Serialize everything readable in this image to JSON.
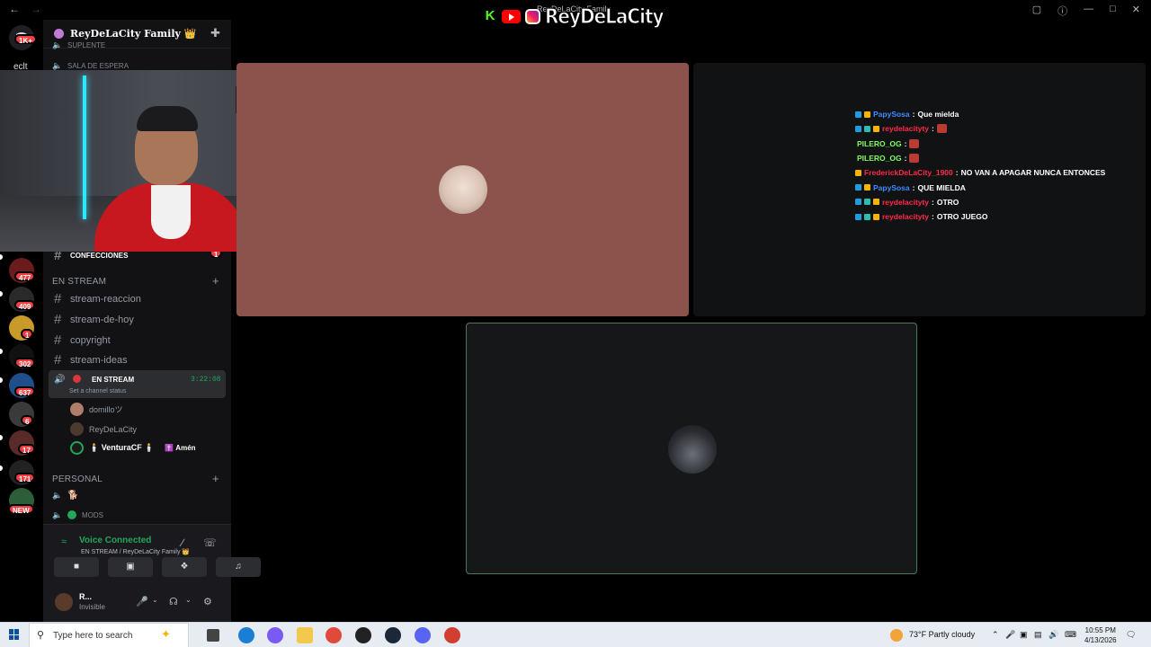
{
  "window": {
    "title": "ReyDeLaCity Family",
    "back": "←",
    "forward": "→",
    "controls": [
      "inbox-icon",
      "help-icon",
      "minimize-icon",
      "maximize-icon",
      "close-icon"
    ]
  },
  "overlay_brand": {
    "name": "ReyDeLaCity",
    "icons": [
      "kick-icon",
      "youtube-icon",
      "instagram-icon"
    ],
    "colors": {
      "kick": "#53fc18",
      "youtube": "#ff0000"
    }
  },
  "rail": {
    "top_badge": "1K+",
    "top_label": "eclt",
    "servers": [
      {
        "badge": "477"
      },
      {
        "badge": "409"
      },
      {
        "badge": "1"
      },
      {
        "badge": "302"
      },
      {
        "badge": "637"
      },
      {
        "badge": "6"
      },
      {
        "badge": "17"
      },
      {
        "badge": "171"
      },
      {
        "badge": "NEW"
      }
    ]
  },
  "sidebar": {
    "server_name": "ReyDeLaCity Family 👑",
    "top_voice": [
      {
        "label": "SUPLENTE"
      },
      {
        "label": "SALA DE ESPERA"
      }
    ],
    "confesiones": {
      "label": "CONFECCIONES",
      "badge": "1"
    },
    "category_stream": "EN STREAM",
    "text_channels": [
      "stream-reaccion",
      "stream-de-hoy",
      "copyright",
      "stream-ideas"
    ],
    "active_voice": {
      "name": "EN STREAM",
      "status": "Set a channel status",
      "timer": "3:22:08"
    },
    "members": [
      {
        "name": "domilloツ",
        "tag": ""
      },
      {
        "name": "ReyDeLaCity",
        "tag": ""
      },
      {
        "name": "🕯️ VenturaCF 🕯️",
        "tag": "✝️ Amén"
      }
    ],
    "category_personal": "PERSONAL",
    "personal_voice": [
      {
        "label": "🐕"
      },
      {
        "label": "MODS"
      }
    ]
  },
  "voice_panel": {
    "title": "Voice Connected",
    "subtitle": "EN STREAM / ReyDeLaCity Family 👑",
    "buttons": [
      "camera-off-icon",
      "screen-share-icon",
      "activities-icon",
      "soundboard-icon"
    ]
  },
  "user_panel": {
    "username": "R...",
    "status": "Invisible"
  },
  "chat": [
    {
      "user": "PapySosa",
      "color": "#3d8bff",
      "text": "Que mielda",
      "emote": false
    },
    {
      "user": "reydelacityty",
      "color": "#ff2a4a",
      "text": "",
      "emote": true
    },
    {
      "user": "PILERO_OG",
      "color": "#7cff59",
      "text": "",
      "emote": true
    },
    {
      "user": "PILERO_OG",
      "color": "#7cff59",
      "text": "",
      "emote": true
    },
    {
      "user": "FrederickDeLaCity_1900",
      "color": "#ff2a4a",
      "text": "NO VAN A APAGAR NUNCA ENTONCES",
      "emote": false
    },
    {
      "user": "PapySosa",
      "color": "#3d8bff",
      "text": "QUE MIELDA",
      "emote": false
    },
    {
      "user": "reydelacityty",
      "color": "#ff2a4a",
      "text": "OTRO",
      "emote": false
    },
    {
      "user": "reydelacityty",
      "color": "#ff2a4a",
      "text": "OTRO JUEGO",
      "emote": false
    }
  ],
  "taskbar": {
    "search_placeholder": "Type here to search",
    "weather": "73°F  Partly cloudy",
    "time": "10:55 PM",
    "date": "4/13/2026"
  }
}
